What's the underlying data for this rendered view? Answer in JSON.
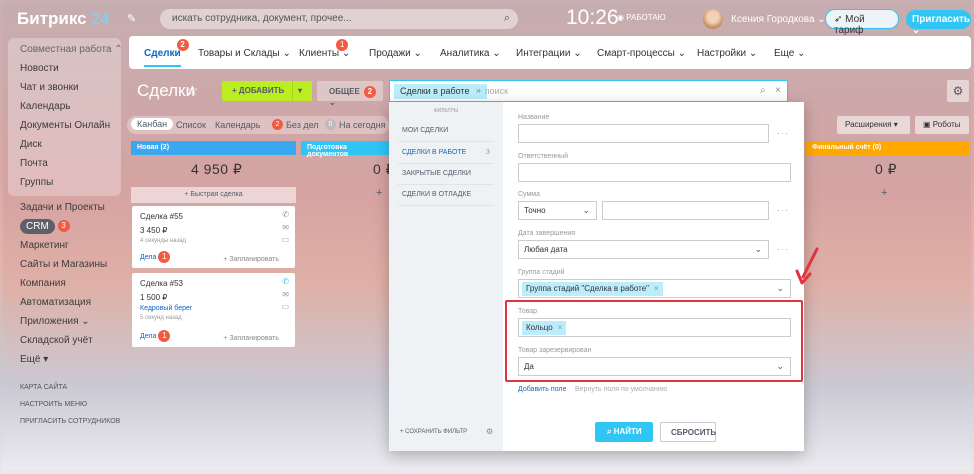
{
  "topbar": {
    "logo_name": "Битрикс",
    "logo_num": "24",
    "search_placeholder": "искать сотрудника, документ, прочее...",
    "time": "10:26",
    "work_status": "РАБОТАЮ",
    "user_name": "Ксения Городкова",
    "tariff_label": "Мой тариф",
    "invite_label": "Пригласить"
  },
  "leftmenu": {
    "group_head": "Совместная работа",
    "group_items": [
      "Новости",
      "Чат и звонки",
      "Календарь",
      "Документы Онлайн",
      "Диск",
      "Почта",
      "Группы"
    ],
    "items": [
      "Задачи и Проекты"
    ],
    "crm_label": "CRM",
    "crm_badge": "3",
    "items2": [
      "Маркетинг",
      "Сайты и Магазины",
      "Компания",
      "Автоматизация"
    ],
    "apps": "Приложения",
    "stock": "Складской учёт",
    "more": "Ещё",
    "small": [
      "КАРТА САЙТА",
      "НАСТРОИТЬ МЕНЮ",
      "ПРИГЛАСИТЬ СОТРУДНИКОВ"
    ]
  },
  "navtabs": [
    {
      "label": "Сделки",
      "badge": "2"
    },
    {
      "label": "Товары и Склады"
    },
    {
      "label": "Клиенты",
      "badge": "1"
    },
    {
      "label": "Продажи"
    },
    {
      "label": "Аналитика"
    },
    {
      "label": "Интеграции"
    },
    {
      "label": "Смарт-процессы"
    },
    {
      "label": "Настройки"
    },
    {
      "label": "Еще"
    }
  ],
  "toolbar": {
    "title": "Сделки",
    "add": "ДОБАВИТЬ",
    "common": "ОБЩЕЕ",
    "common_badge": "2",
    "filter_chip": "Сделки в работе",
    "filter_placeholder": "+ поиск"
  },
  "views": {
    "kanban": "Канбан",
    "list": "Список",
    "calendar": "Календарь",
    "no_deals_badge": "2",
    "no_deals": "Без дел",
    "today_badge": "0",
    "today": "На сегодня",
    "ext": "Расширения",
    "robots": "Роботы"
  },
  "kanban": {
    "col1": "Новая (2)",
    "col1_sum": "4 950 ₽",
    "col2": "Подготовка документов",
    "col2_sum": "0 ₽",
    "col3": "Финальный счёт (0)",
    "col3_sum": "0 ₽",
    "quick": "Быстрая сделка",
    "cards": [
      {
        "title": "Сделка #55",
        "sum": "3 450 ₽",
        "sub": "",
        "time": "4 секунды назад",
        "deals": "Дела",
        "badge": "1",
        "plan": "+ Запланировать"
      },
      {
        "title": "Сделка #53",
        "sum": "1 500 ₽",
        "sub": "Кедровый берег",
        "time": "5 секунд назад",
        "deals": "Дела",
        "badge": "1",
        "plan": "+ Запланировать"
      }
    ]
  },
  "popup": {
    "list_title": "ФИЛЬТРЫ",
    "presets": [
      "МОИ СДЕЛКИ",
      "СДЕЛКИ В РАБОТЕ",
      "ЗАКРЫТЫЕ СДЕЛКИ",
      "СДЕЛКИ В ОТЛАДКЕ"
    ],
    "preset_count": "3",
    "save": "СОХРАНИТЬ ФИЛЬТР",
    "f_name": "Название",
    "f_resp": "Ответственный",
    "f_sum": "Сумма",
    "f_sum_mode": "Точно",
    "f_date": "Дата завершения",
    "f_date_val": "Любая дата",
    "f_stage": "Группа стадий",
    "f_stage_tag": "Группа стадий \"Сделка в работе\"",
    "f_product": "Товар",
    "f_product_tag": "Кольцо",
    "f_reserved": "Товар зарезервирован",
    "f_reserved_val": "Да",
    "add_field": "Добавить поле",
    "restore": "Вернуть поля по умолчанию",
    "find": "НАЙТИ",
    "reset": "СБРОСИТЬ"
  },
  "colors": {
    "accent": "#2fc6f6",
    "add_btn": "#bbed21",
    "highlight": "#e3343d"
  }
}
